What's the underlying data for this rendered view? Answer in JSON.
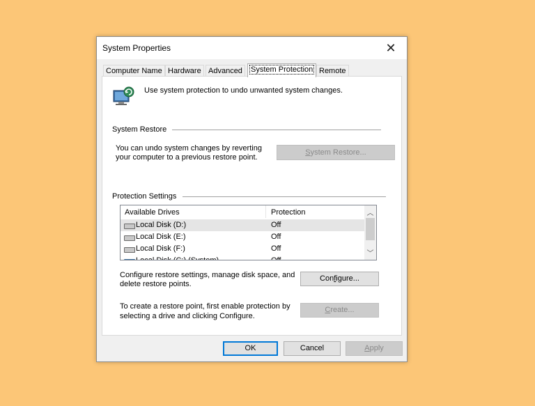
{
  "window": {
    "title": "System Properties"
  },
  "tabs": [
    {
      "label": "Computer Name"
    },
    {
      "label": "Hardware"
    },
    {
      "label": "Advanced"
    },
    {
      "label": "System Protection"
    },
    {
      "label": "Remote"
    }
  ],
  "intro_text": "Use system protection to undo unwanted system changes.",
  "system_restore": {
    "heading": "System Restore",
    "description_line1": "You can undo system changes by reverting",
    "description_line2": "your computer to a previous restore point.",
    "button_prefix": "",
    "button_accel": "S",
    "button_rest": "ystem Restore..."
  },
  "protection": {
    "heading": "Protection Settings",
    "columns": [
      "Available Drives",
      "Protection"
    ],
    "drives": [
      {
        "name": "Local Disk (D:)",
        "status": "Off",
        "icon": "hard-drive-icon"
      },
      {
        "name": "Local Disk (E:)",
        "status": "Off",
        "icon": "hard-drive-icon"
      },
      {
        "name": "Local Disk (F:)",
        "status": "Off",
        "icon": "hard-drive-icon"
      },
      {
        "name": "Local Disk (C:) (System)",
        "status": "Off",
        "icon": "system-drive-icon"
      }
    ],
    "configure_line1": "Configure restore settings, manage disk space, and",
    "configure_line2": "delete restore points.",
    "configure_prefix": "Con",
    "configure_accel": "f",
    "configure_rest": "igure...",
    "create_line1": "To create a restore point, first enable protection by",
    "create_line2": "selecting a drive and clicking Configure.",
    "create_accel": "C",
    "create_rest": "reate..."
  },
  "footer": {
    "ok": "OK",
    "cancel": "Cancel",
    "apply_accel": "A",
    "apply_rest": "pply"
  }
}
